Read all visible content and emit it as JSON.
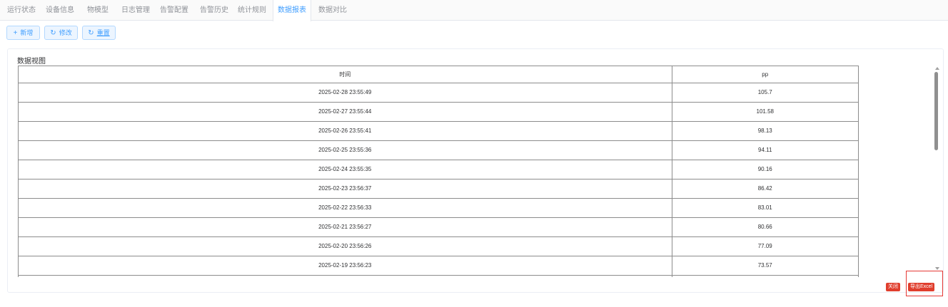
{
  "tabs": [
    {
      "label": "运行状态"
    },
    {
      "label": "设备信息"
    },
    {
      "label": "物模型"
    },
    {
      "label": "日志管理"
    },
    {
      "label": "告警配置"
    },
    {
      "label": "告警历史"
    },
    {
      "label": "统计规则"
    },
    {
      "label": "数据报表",
      "active": true
    },
    {
      "label": "数据对比"
    }
  ],
  "toolbar": {
    "add_label": "新增",
    "edit_label": "修改",
    "reset_label": "重置"
  },
  "panel": {
    "title": "数据视图"
  },
  "table": {
    "columns": [
      "时间",
      "pp"
    ],
    "rows": [
      [
        "2025-02-28 23:55:49",
        "105.7"
      ],
      [
        "2025-02-27 23:55:44",
        "101.58"
      ],
      [
        "2025-02-26 23:55:41",
        "98.13"
      ],
      [
        "2025-02-25 23:55:36",
        "94.11"
      ],
      [
        "2025-02-24 23:55:35",
        "90.16"
      ],
      [
        "2025-02-23 23:56:37",
        "86.42"
      ],
      [
        "2025-02-22 23:56:33",
        "83.01"
      ],
      [
        "2025-02-21 23:56:27",
        "80.66"
      ],
      [
        "2025-02-20 23:56:26",
        "77.09"
      ],
      [
        "2025-02-19 23:56:23",
        "73.57"
      ],
      [
        "",
        ""
      ]
    ]
  },
  "footer": {
    "close_label": "关闭",
    "export_label": "导出Excel"
  },
  "colors": {
    "accent": "#409eff",
    "danger": "#e03e2d",
    "highlight": "#e53935"
  }
}
